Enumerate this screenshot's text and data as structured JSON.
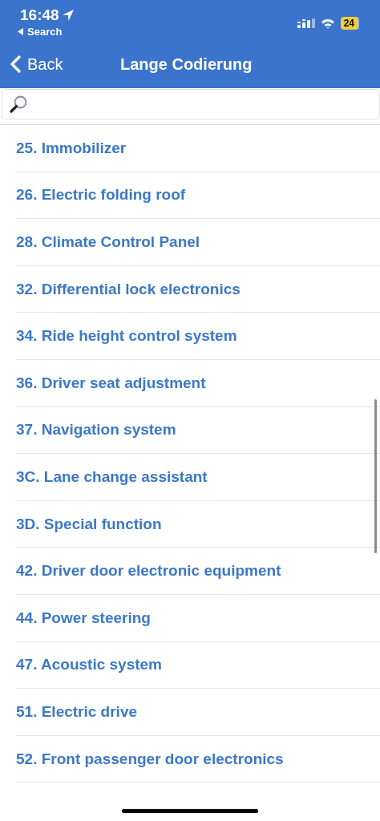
{
  "status_bar": {
    "time": "16:48",
    "back_app": "Search",
    "battery": "24"
  },
  "nav_bar": {
    "back": "Back",
    "title": "Lange Codierung"
  },
  "items": [
    "25. Immobilizer",
    "26. Electric folding roof",
    "28. Climate Control Panel",
    "32. Differential lock electronics",
    "34. Ride height control system",
    "36. Driver seat adjustment",
    "37. Navigation system",
    "3C. Lane change assistant",
    "3D. Special function",
    "42. Driver door electronic equipment",
    "44. Power steering",
    "47. Acoustic system",
    "51. Electric drive",
    "52. Front passenger door electronics"
  ]
}
